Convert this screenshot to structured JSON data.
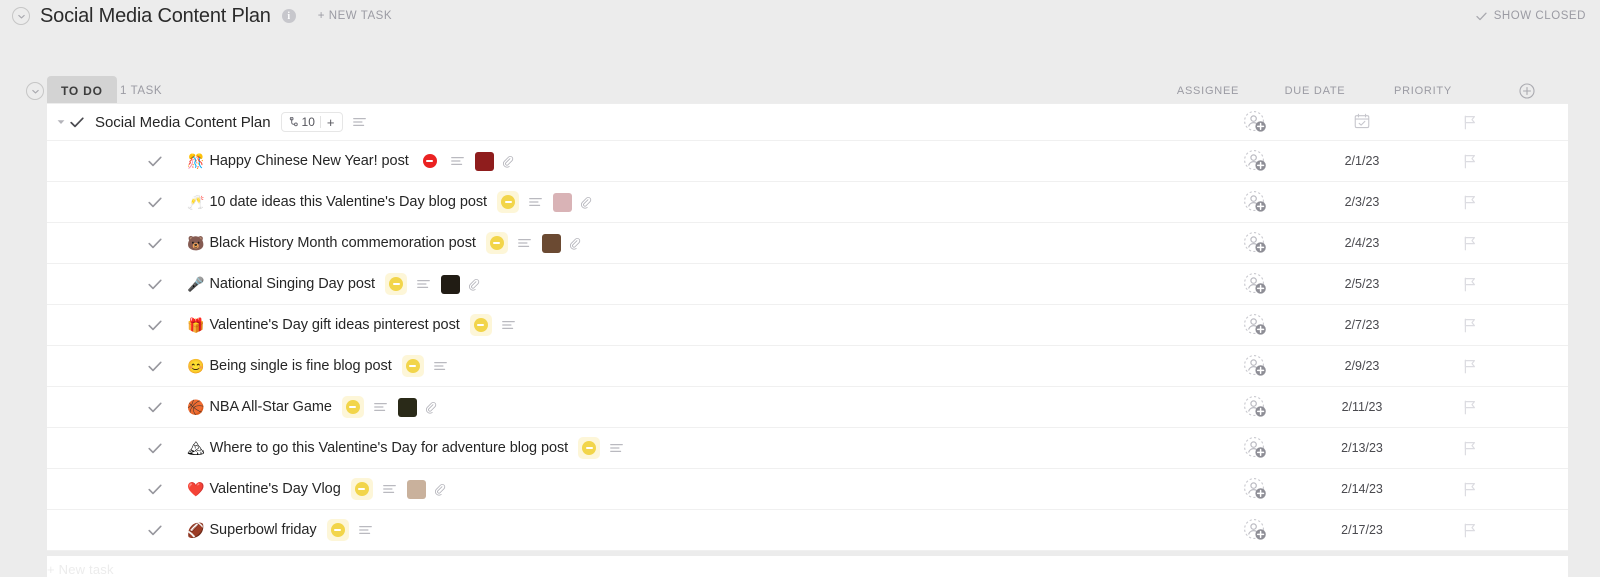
{
  "header": {
    "title": "Social Media Content Plan",
    "info_icon": "info-icon",
    "new_task_label": "+ NEW TASK",
    "show_closed_label": "SHOW CLOSED",
    "collapse_icon": "chevron-down-circle-icon"
  },
  "list_header": {
    "status_label": "TO DO",
    "task_count": "1 TASK",
    "columns": {
      "assignee": "ASSIGNEE",
      "due_date": "DUE DATE",
      "priority": "PRIORITY",
      "add_column_icon": "plus-circle-icon"
    }
  },
  "colors": {
    "page_bg": "#ececec",
    "panel_bg": "#ffffff",
    "status_pill_bg": "#d3d3d3",
    "muted_text": "#9b9ba3",
    "title_text": "#2b2b2b",
    "status_red": "#ea2222",
    "status_yellow": "#f2d54a",
    "status_yellow_sel_bg": "#fdf6d8",
    "row_border": "#f0f0f0"
  },
  "parent_task": {
    "name": "Social Media Content Plan",
    "subtask_count": "10",
    "add_subtask_label": "+",
    "due_date_icon": "calendar-check-icon",
    "has_description": true,
    "checkmark_icon": "check-icon",
    "collapse_icon": "triangle-down-icon"
  },
  "tasks": [
    {
      "emoji": "🎊",
      "name": "Happy Chinese New Year! post",
      "status": "blocked",
      "status_color": "#ea2222",
      "status_selected": false,
      "has_description": true,
      "thumbnail": "#8f1d1d",
      "has_attachment": true,
      "due_date": "2/1/23",
      "priority": "none"
    },
    {
      "emoji": "🥂",
      "name": "10 date ideas this Valentine's Day blog post",
      "status": "in-progress",
      "status_color": "#f2d54a",
      "status_selected": true,
      "has_description": true,
      "thumbnail": "#d9b3b6",
      "has_attachment": true,
      "due_date": "2/3/23",
      "priority": "none"
    },
    {
      "emoji": "🐻",
      "name": "Black History Month commemoration post",
      "status": "in-progress",
      "status_color": "#f2d54a",
      "status_selected": true,
      "has_description": true,
      "thumbnail": "#6b4a32",
      "has_attachment": true,
      "due_date": "2/4/23",
      "priority": "none"
    },
    {
      "emoji": "🎤",
      "name": "National Singing Day post",
      "status": "in-progress",
      "status_color": "#f2d54a",
      "status_selected": true,
      "has_description": true,
      "thumbnail": "#211c14",
      "has_attachment": true,
      "due_date": "2/5/23",
      "priority": "none"
    },
    {
      "emoji": "🎁",
      "name": "Valentine's Day gift ideas pinterest post",
      "status": "in-progress",
      "status_color": "#f2d54a",
      "status_selected": true,
      "has_description": true,
      "thumbnail": null,
      "has_attachment": false,
      "due_date": "2/7/23",
      "priority": "none"
    },
    {
      "emoji": "😊",
      "name": "Being single is fine blog post",
      "status": "in-progress",
      "status_color": "#f2d54a",
      "status_selected": true,
      "has_description": true,
      "thumbnail": null,
      "has_attachment": false,
      "due_date": "2/9/23",
      "priority": "none"
    },
    {
      "emoji": "🏀",
      "name": "NBA All-Star Game",
      "status": "in-progress",
      "status_color": "#f2d54a",
      "status_selected": true,
      "has_description": true,
      "thumbnail": "#2a2a18",
      "has_attachment": true,
      "due_date": "2/11/23",
      "priority": "none"
    },
    {
      "emoji": "🏔",
      "name": "Where to go this Valentine's Day for adventure blog post",
      "status": "in-progress",
      "status_color": "#f2d54a",
      "status_selected": true,
      "has_description": true,
      "thumbnail": null,
      "has_attachment": false,
      "due_date": "2/13/23",
      "priority": "none"
    },
    {
      "emoji": "❤️",
      "name": "Valentine's Day Vlog",
      "status": "in-progress",
      "status_color": "#f2d54a",
      "status_selected": true,
      "has_description": true,
      "thumbnail": "#c9b19c",
      "has_attachment": true,
      "due_date": "2/14/23",
      "priority": "none"
    },
    {
      "emoji": "🏈",
      "name": "Superbowl friday",
      "status": "in-progress",
      "status_color": "#f2d54a",
      "status_selected": true,
      "has_description": true,
      "thumbnail": null,
      "has_attachment": false,
      "due_date": "2/17/23",
      "priority": "none"
    }
  ],
  "footer": {
    "new_task_label": "+ New task"
  }
}
